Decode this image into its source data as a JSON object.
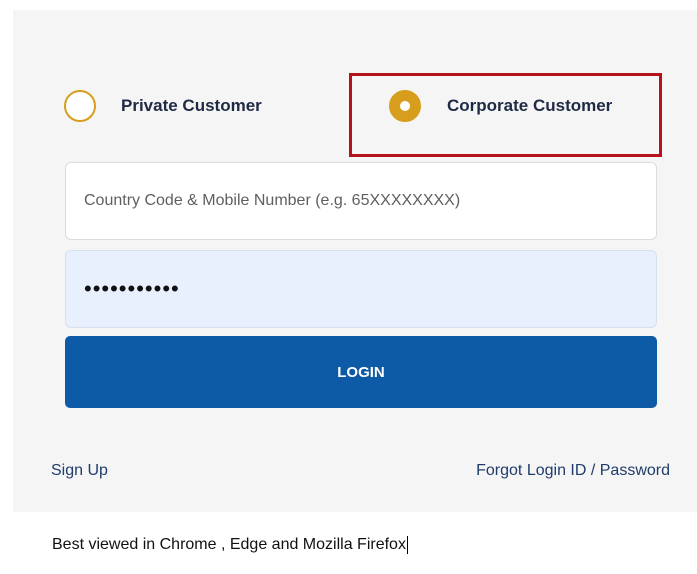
{
  "customer_type": {
    "options": [
      {
        "label": "Private Customer",
        "selected": false
      },
      {
        "label": "Corporate Customer",
        "selected": true
      }
    ]
  },
  "form": {
    "mobile_placeholder": "Country Code & Mobile Number (e.g. 65XXXXXXXX)",
    "mobile_value": "",
    "password_value": "•••••••••••",
    "login_label": "LOGIN"
  },
  "links": {
    "sign_up": "Sign Up",
    "forgot": "Forgot Login ID / Password"
  },
  "footer": {
    "note": "Best viewed in Chrome , Edge and Mozilla Firefox"
  },
  "colors": {
    "radio_accent": "#d69e1c",
    "login_button": "#0d5aa7",
    "highlight_border": "#b5121b"
  }
}
